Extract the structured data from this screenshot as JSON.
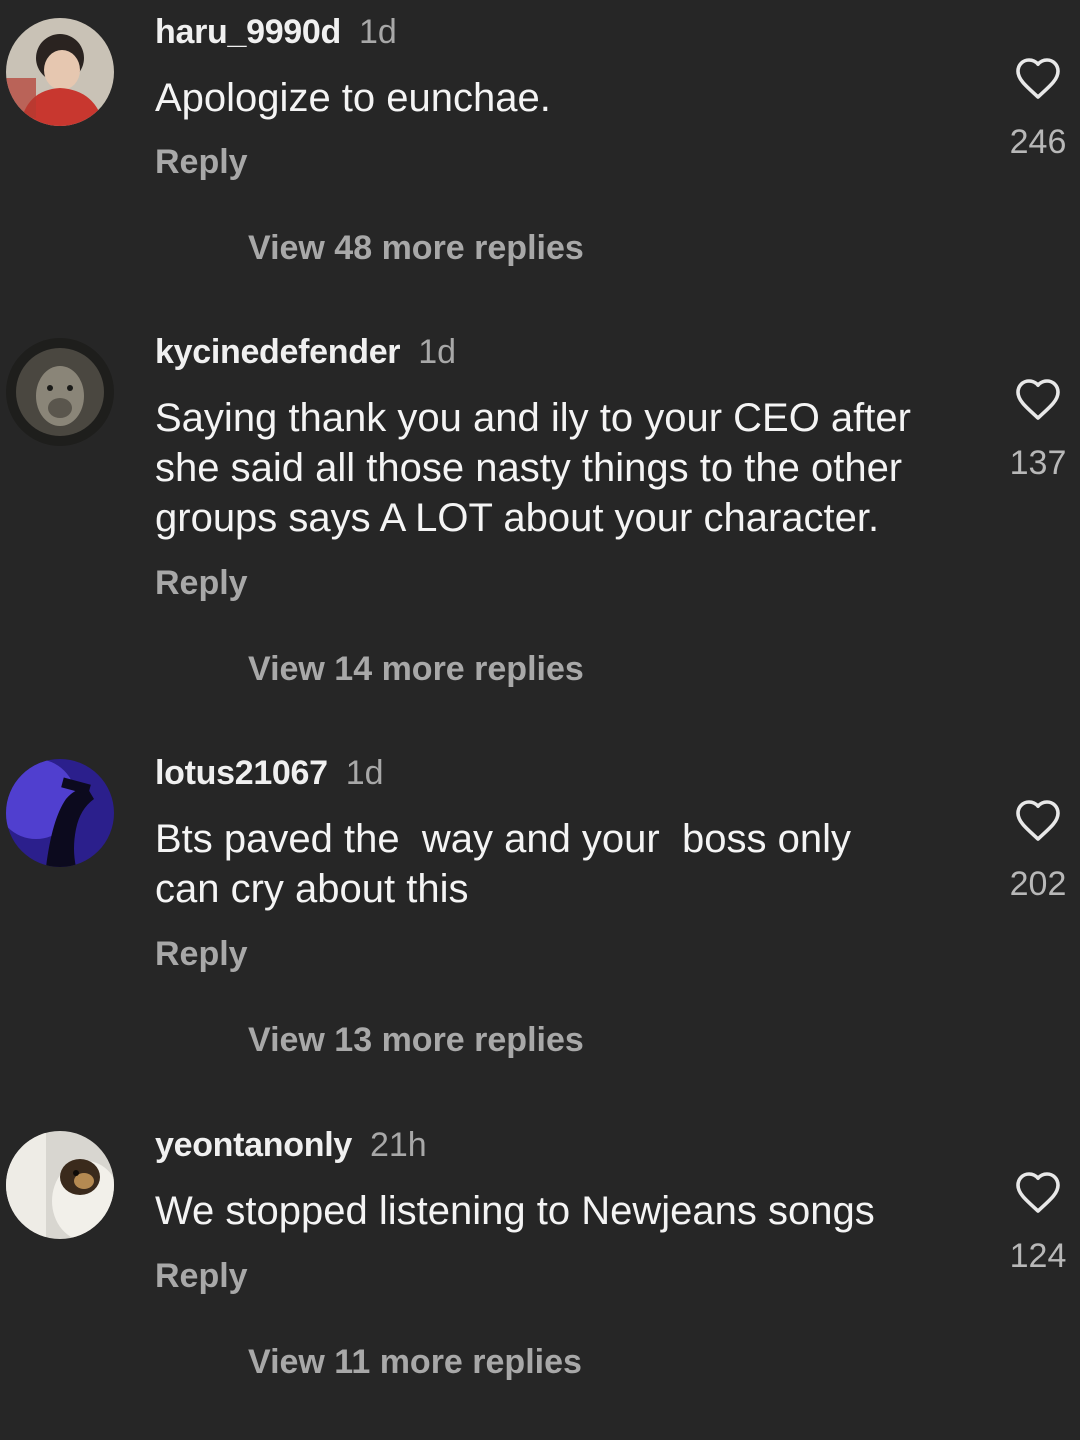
{
  "comments": [
    {
      "username": "haru_9990d",
      "time": "1d",
      "text": "Apologize to eunchae.",
      "reply_label": "Reply",
      "view_replies": "View 48 more replies",
      "likes": "246",
      "avatar": "person-photo"
    },
    {
      "username": "kycinedefender",
      "time": "1d",
      "text": "Saying thank you and ily to your CEO after\nshe said all those nasty things to the other\ngroups says A LOT about your character.",
      "reply_label": "Reply",
      "view_replies": "View 14 more replies",
      "likes": "137",
      "avatar": "lion-photo"
    },
    {
      "username": "lotus21067",
      "time": "1d",
      "text": "Bts paved the  way and your  boss only\ncan cry about this",
      "reply_label": "Reply",
      "view_replies": "View 13 more replies",
      "likes": "202",
      "avatar": "purple-silhouette-photo"
    },
    {
      "username": "yeontanonly",
      "time": "21h",
      "text": "We stopped listening to Newjeans songs",
      "reply_label": "Reply",
      "view_replies": "View 11 more replies",
      "likes": "124",
      "avatar": "dog-photo"
    }
  ],
  "icons": {
    "like": "heart-outline-icon"
  },
  "colors": {
    "background": "#262626",
    "primary_text": "#f4f4f4",
    "secondary_text": "#a8a8a8"
  }
}
